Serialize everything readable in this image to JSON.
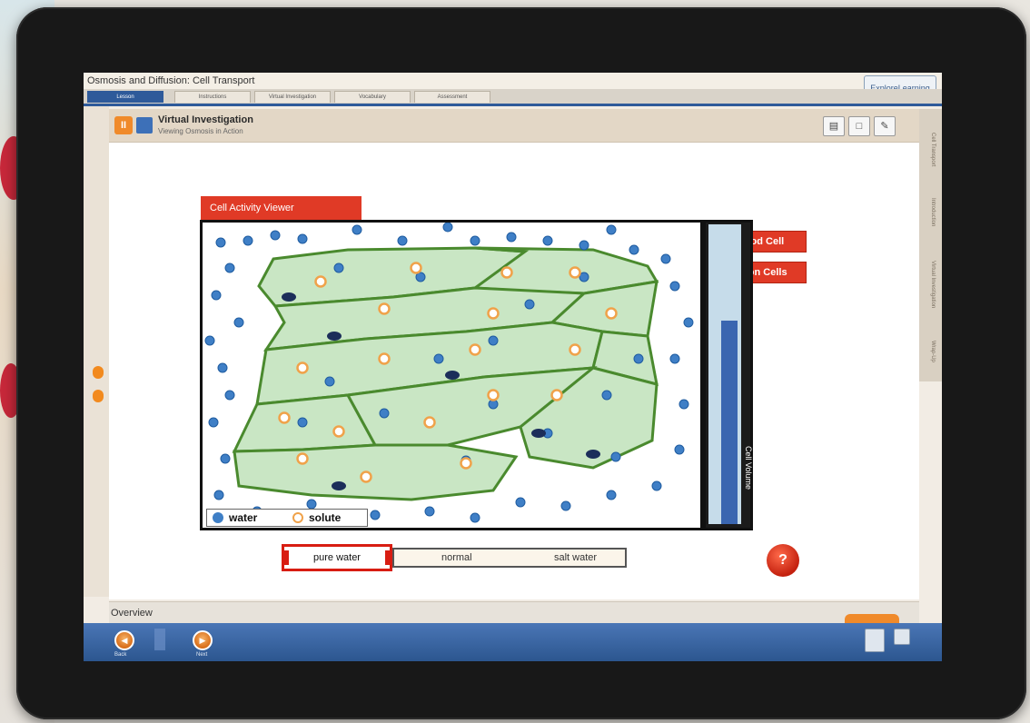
{
  "window": {
    "title": "Osmosis and Diffusion: Cell Transport",
    "logo": "ExploreLearning"
  },
  "tabs": [
    {
      "label": "Lesson",
      "active": true
    },
    {
      "label": "Instructions",
      "active": false
    },
    {
      "label": "Virtual Investigation",
      "active": false
    },
    {
      "label": "Vocabulary",
      "active": false
    },
    {
      "label": "Assessment",
      "active": false
    }
  ],
  "right_tabs": [
    "Cell Transport",
    "Introduction",
    "Virtual Investigation",
    "Wrap-Up"
  ],
  "header": {
    "title": "Virtual Investigation",
    "subtitle": "Viewing Osmosis in Action",
    "icons": [
      "glossary-icon",
      "notebook-icon",
      "pencil-icon"
    ]
  },
  "cell_buttons": {
    "blood": "Blood Cell",
    "onion": "Onion Cells"
  },
  "viewer": {
    "label": "Cell Activity Viewer",
    "legend_water": "water",
    "legend_solute": "solute",
    "volume_label": "Cell Volume",
    "volume_level": 0.68
  },
  "solution": {
    "selected": "pure water",
    "options": [
      "normal",
      "salt water"
    ]
  },
  "help_label": "?",
  "overview_label": "Overview",
  "nav": {
    "buttons": [
      "Back",
      "Next"
    ]
  },
  "colors": {
    "accent_red": "#e03a26",
    "water": "#3f7fc6",
    "solute": "#f0a24a",
    "cell_fill": "#c9e6c4",
    "cell_wall": "#4a8a2e",
    "nav_blue": "#2e5a9a"
  }
}
